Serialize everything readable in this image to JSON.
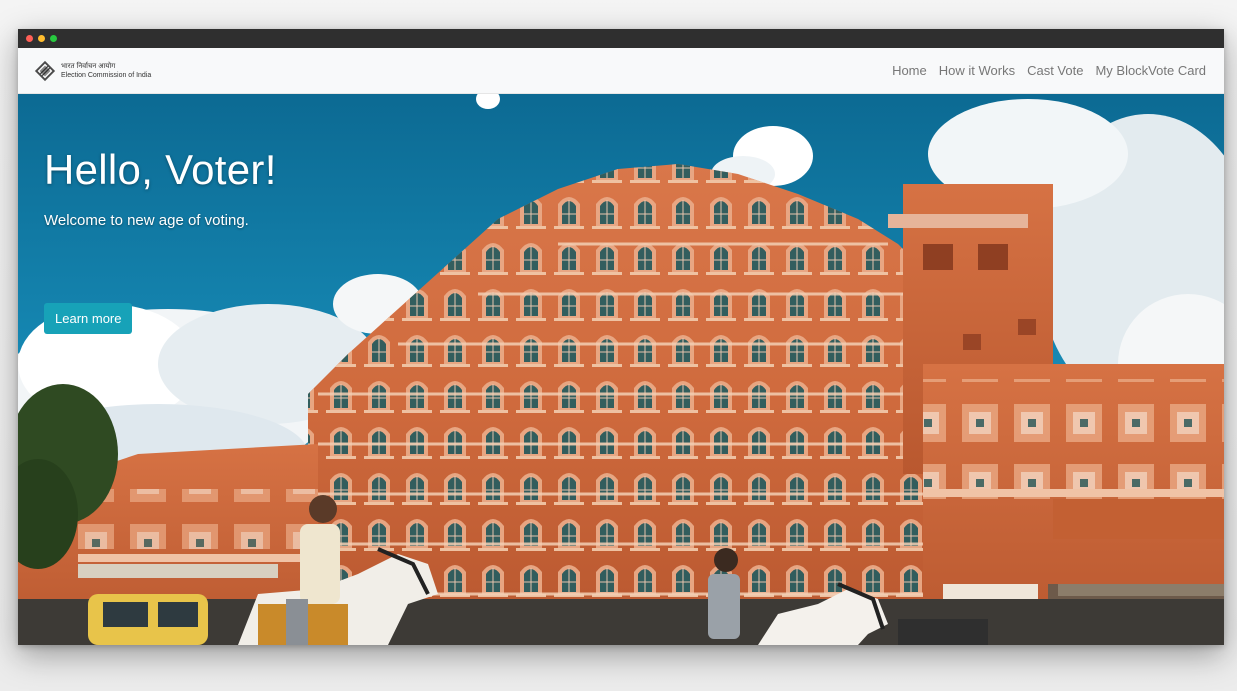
{
  "window": {
    "controls": [
      "close",
      "minimize",
      "maximize"
    ],
    "control_colors": [
      "#ff5f56",
      "#ffbd2e",
      "#27c93f"
    ]
  },
  "navbar": {
    "brand": {
      "logo_icon": "eci-ballot-logo-icon",
      "line1": "भारत निर्वाचन आयोग",
      "line2": "Election Commission of India"
    },
    "links": [
      {
        "label": "Home"
      },
      {
        "label": "How it Works"
      },
      {
        "label": "Cast Vote"
      },
      {
        "label": "My BlockVote Card"
      }
    ]
  },
  "hero": {
    "title": "Hello, Voter!",
    "subtitle": "Welcome to new age of voting.",
    "button_label": "Learn more",
    "accent_color": "#17a2b8",
    "background_image": "photo of Hawa Mahal palace facade in Jaipur with blue sky, clouds, horses and tuk-tuk"
  }
}
